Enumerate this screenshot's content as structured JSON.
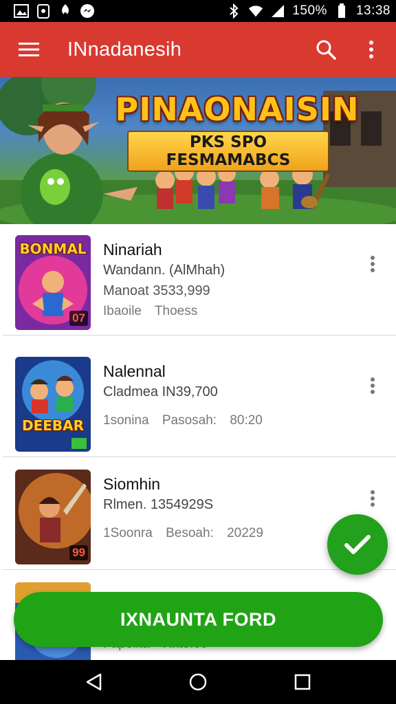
{
  "status_bar": {
    "battery_text": "150%",
    "time": "13:38"
  },
  "app_bar": {
    "title": "INnadanesih"
  },
  "banner": {
    "title": "PINAONAISIN",
    "subtitle": "PKS SPO FESMAMABCS"
  },
  "list": {
    "items": [
      {
        "title": "Ninariah",
        "line1": "Wandann. (AlMhah)",
        "line2": "Manoat 3533,999",
        "line3": "Ibaoile Thoess",
        "thumb_logo": "BONMAL",
        "thumb_badge": "07"
      },
      {
        "title": "Nalennal",
        "line1": "Cladmea IN39,700",
        "line2": "",
        "line3": "1sonina Pasosah: 80:20",
        "thumb_logo": "DEEBAR",
        "thumb_badge": ""
      },
      {
        "title": "Siomhin",
        "line1": "Rlmen. 1354929S",
        "line2": "",
        "line3": "1Soonra Besoah: 20229",
        "thumb_logo": "",
        "thumb_badge": "99"
      },
      {
        "title": "",
        "line1": "",
        "line2": "",
        "line3": "Fapolita Rkto.00",
        "thumb_logo": "",
        "thumb_badge": ""
      }
    ]
  },
  "cta": {
    "label": "IXNAUNTA FORD"
  },
  "colors": {
    "app_bar": "#d93a30",
    "accent_green": "#21a316"
  },
  "icons": [
    "image-icon",
    "clipboard-icon",
    "location-icon",
    "messenger-icon",
    "bluetooth-icon",
    "wifi-icon",
    "signal-icon",
    "battery-icon",
    "menu-icon",
    "search-icon",
    "more-vert-icon",
    "check-icon",
    "back-icon",
    "home-icon",
    "recents-icon"
  ]
}
